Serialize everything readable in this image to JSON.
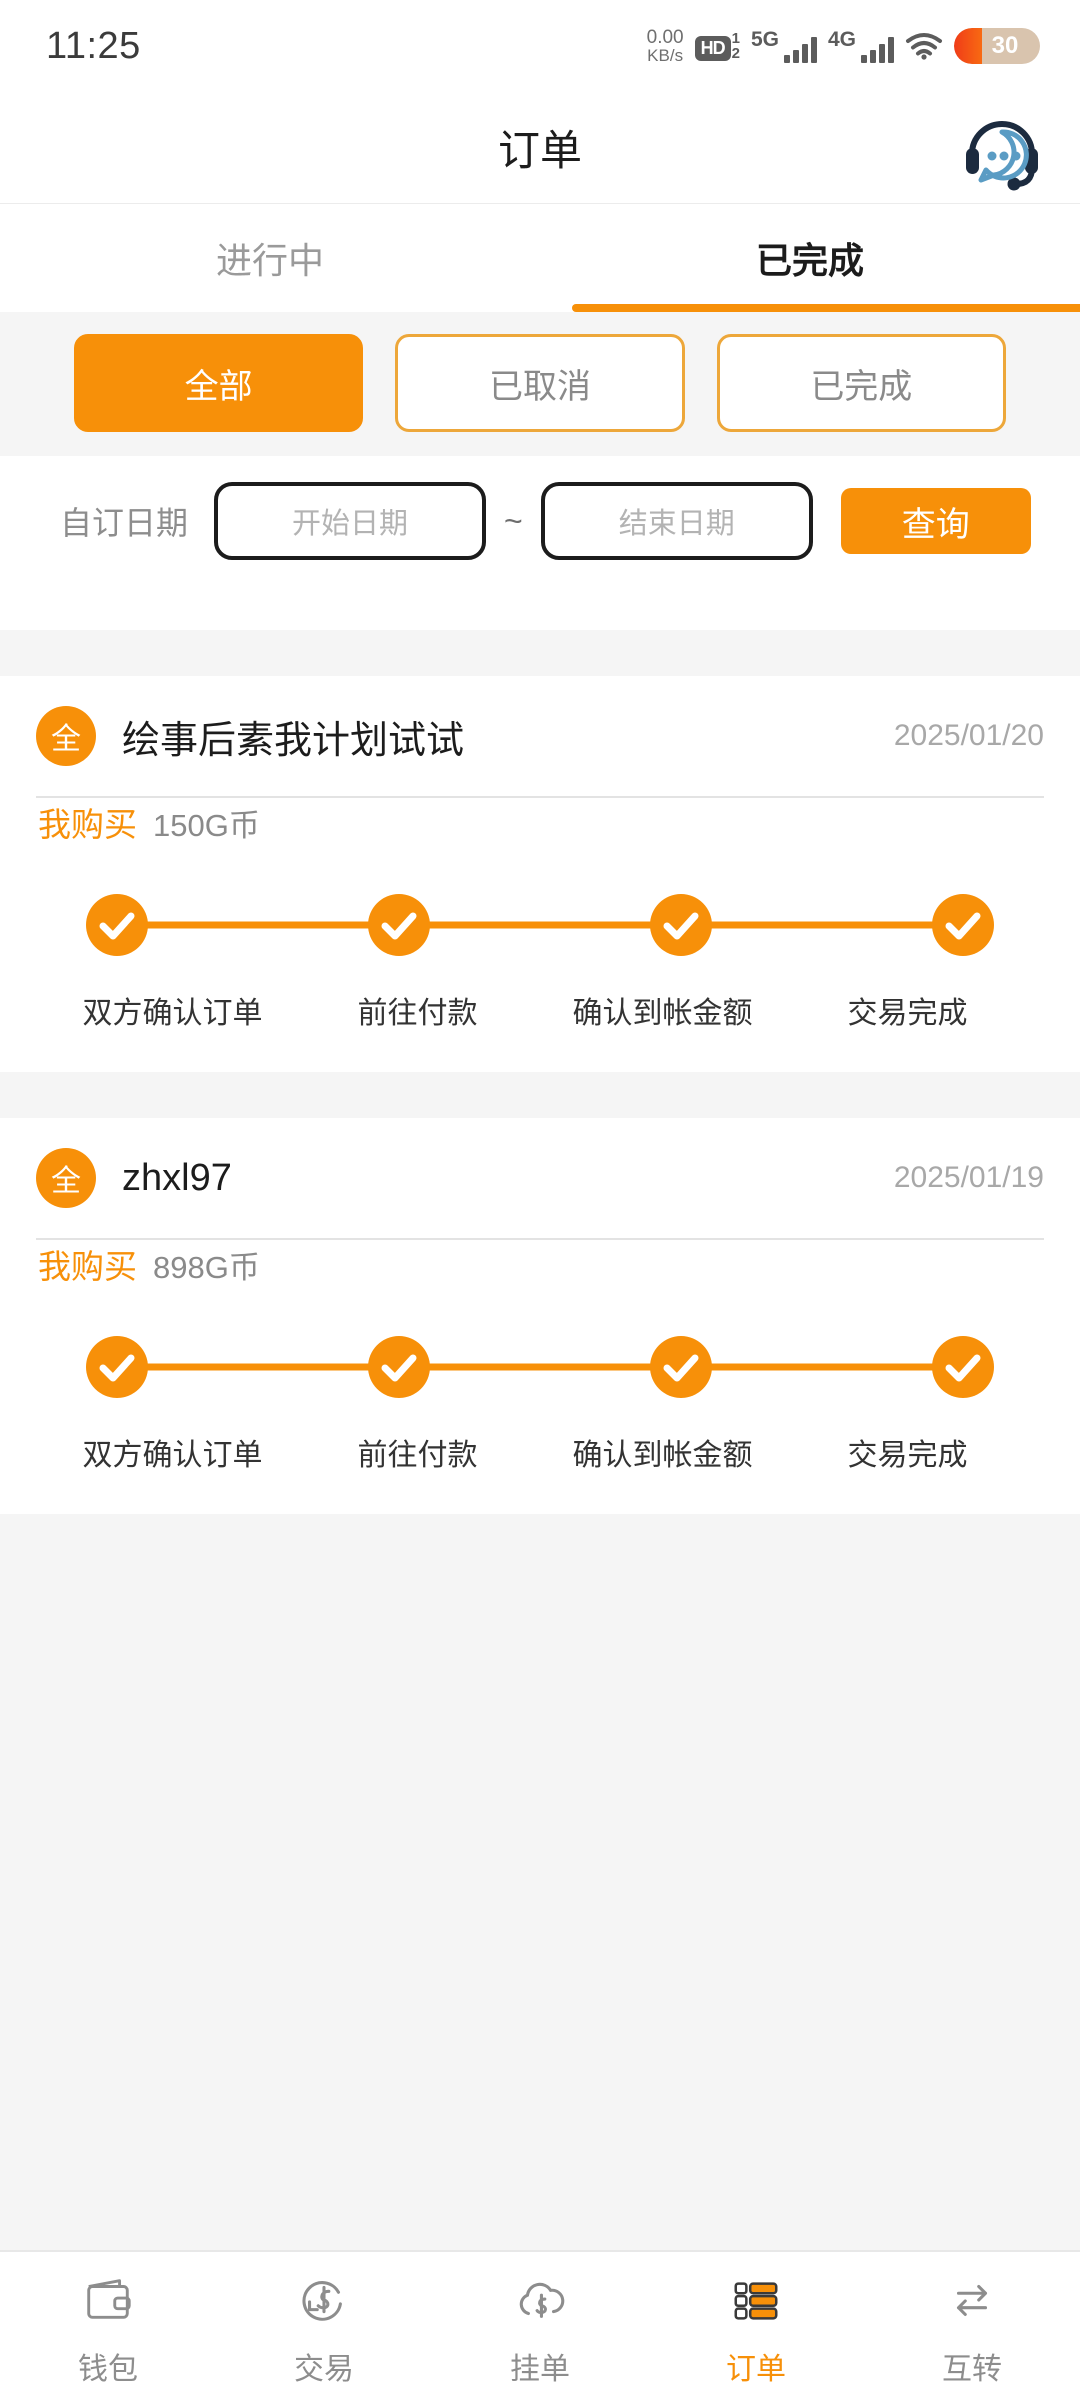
{
  "status_bar": {
    "time": "11:25",
    "net_speed_value": "0.00",
    "net_speed_unit": "KB/s",
    "hd_label": "HD",
    "sim_top": "1",
    "sim_bottom": "2",
    "sig1_label": "5G",
    "sig2_label": "4G",
    "battery_level": "30"
  },
  "header": {
    "title": "订单",
    "support_icon": "customer-service-icon"
  },
  "tabs": [
    {
      "label": "进行中",
      "active": false
    },
    {
      "label": "已完成",
      "active": true
    }
  ],
  "filter_chips": [
    {
      "label": "全部",
      "active": true
    },
    {
      "label": "已取消",
      "active": false
    },
    {
      "label": "已完成",
      "active": false
    }
  ],
  "date_filter": {
    "label": "自订日期",
    "start_placeholder": "开始日期",
    "start_value": "",
    "separator": "~",
    "end_placeholder": "结束日期",
    "end_value": "",
    "query_label": "查询"
  },
  "orders": [
    {
      "badge": "全",
      "title": "绘事后素我计划试试",
      "date": "2025/01/20",
      "buy_label": "我购买",
      "amount": "150G币",
      "steps": [
        {
          "label": "双方确认订单",
          "done": true
        },
        {
          "label": "前往付款",
          "done": true
        },
        {
          "label": "确认到帐金额",
          "done": true
        },
        {
          "label": "交易完成",
          "done": true
        }
      ]
    },
    {
      "badge": "全",
      "title": "zhxl97",
      "date": "2025/01/19",
      "buy_label": "我购买",
      "amount": "898G币",
      "steps": [
        {
          "label": "双方确认订单",
          "done": true
        },
        {
          "label": "前往付款",
          "done": true
        },
        {
          "label": "确认到帐金额",
          "done": true
        },
        {
          "label": "交易完成",
          "done": true
        }
      ]
    }
  ],
  "bottom_nav": [
    {
      "label": "钱包",
      "icon": "wallet-icon",
      "active": false
    },
    {
      "label": "交易",
      "icon": "trade-dollar-icon",
      "active": false
    },
    {
      "label": "挂单",
      "icon": "cloud-dollar-icon",
      "active": false
    },
    {
      "label": "订单",
      "icon": "orders-list-icon",
      "active": true
    },
    {
      "label": "互转",
      "icon": "transfer-arrows-icon",
      "active": false
    }
  ],
  "colors": {
    "accent": "#f79009",
    "page_bg": "#f5f5f5",
    "card_bg": "#ffffff",
    "muted_text": "#8d8d8d"
  }
}
